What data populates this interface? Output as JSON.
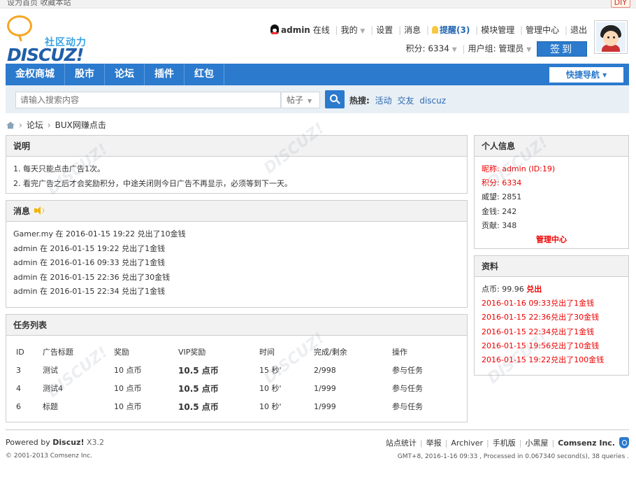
{
  "topbar": {
    "left": "设为首页 收藏本站",
    "diy": "DIY"
  },
  "logo": {
    "sub": "社区动力",
    "brand": "DISCUZ!"
  },
  "user": {
    "name": "admin",
    "online": "在线",
    "mine": "我的",
    "settings": "设置",
    "messages": "消息",
    "reminder": "提醒(3)",
    "module_mgmt": "模块管理",
    "admin_center": "管理中心",
    "logout": "退出",
    "points": "积分: 6334",
    "usergroup": "用户组: 管理员",
    "signin": "签到"
  },
  "nav": {
    "items": [
      "金权商城",
      "股市",
      "论坛",
      "插件",
      "红包"
    ],
    "quick": "快捷导航 ▾"
  },
  "search": {
    "placeholder": "请输入搜索内容",
    "type": "帖子",
    "hot_label": "热搜:",
    "hot_terms": [
      "活动",
      "交友",
      "discuz"
    ]
  },
  "breadcrumb": {
    "forum": "论坛",
    "current": "BUX网赚点击"
  },
  "notice": {
    "title": "说明",
    "lines": [
      "1. 每天只能点击广告1次。",
      "2. 看完广告之后才会奖励积分，中途关闭则今日广告不再显示，必须等到下一天。"
    ]
  },
  "messages": {
    "title": "消息",
    "lines": [
      "Gamer.my 在 2016-01-15 19:22 兑出了10金钱",
      "admin 在 2016-01-15 19:22 兑出了1金钱",
      "admin 在 2016-01-16 09:33 兑出了1金钱",
      "admin 在 2016-01-15 22:36 兑出了30金钱",
      "admin 在 2016-01-15 22:34 兑出了1金钱"
    ]
  },
  "tasks": {
    "title": "任务列表",
    "headers": [
      "ID",
      "广告标题",
      "奖励",
      "VIP奖励",
      "时间",
      "完成/剩余",
      "操作"
    ],
    "rows": [
      {
        "id": "3",
        "title": "测试",
        "reward": "10 点币",
        "vip": "10.5 点币",
        "time": "15 秒'",
        "progress": "2/998",
        "action": "参与任务"
      },
      {
        "id": "4",
        "title": "测试4",
        "reward": "10 点币",
        "vip": "10.5 点币",
        "time": "10 秒'",
        "progress": "1/999",
        "action": "参与任务"
      },
      {
        "id": "6",
        "title": "标题",
        "reward": "10 点币",
        "vip": "10.5 点币",
        "time": "10 秒'",
        "progress": "1/999",
        "action": "参与任务"
      }
    ]
  },
  "profile": {
    "title": "个人信息",
    "nickname": "昵称: admin (ID:19)",
    "points": "积分: 6334",
    "prestige": "威望: 2851",
    "money": "金钱: 242",
    "contribution": "贡献: 348",
    "admin_link": "管理中心"
  },
  "assets": {
    "title": "资料",
    "coins": "点币: 99.96",
    "redeem": "兑出",
    "history": [
      "2016-01-16 09:33兑出了1金钱",
      "2016-01-15 22:36兑出了30金钱",
      "2016-01-15 22:34兑出了1金钱",
      "2016-01-15 19:56兑出了10金钱",
      "2016-01-15 19:22兑出了100金钱"
    ]
  },
  "footer": {
    "powered_prefix": "Powered by",
    "powered_brand": "Discuz!",
    "version": "X3.2",
    "copyright": "© 2001-2013 Comsenz Inc.",
    "links": [
      "站点统计",
      "举报",
      "Archiver",
      "手机版",
      "小黑屋"
    ],
    "company": "Comsenz Inc.",
    "gmt": "GMT+8, 2016-1-16 09:33 , Processed in 0.067340 second(s), 38 queries ."
  },
  "colors": {
    "accent": "#2b7acd",
    "highlight": "#e00000"
  }
}
